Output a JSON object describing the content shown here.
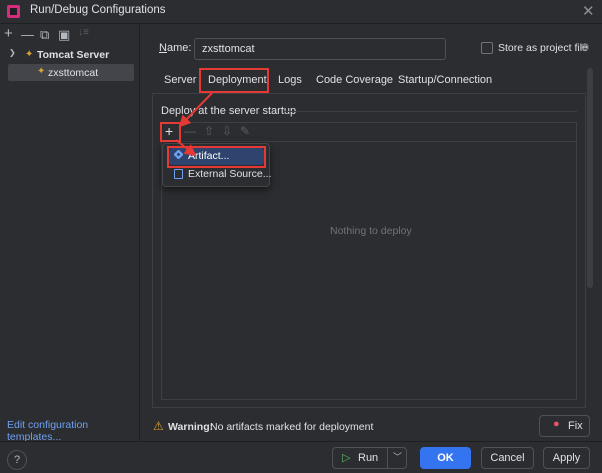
{
  "window": {
    "title": "Run/Debug Configurations",
    "close_glyph": "✕"
  },
  "left": {
    "toolbar": {
      "add": "+",
      "remove": "—",
      "copy": "⧉",
      "folder": "▣",
      "sort": "↓≡"
    },
    "tree": [
      {
        "label": "Tomcat Server",
        "icon": "tomcat-icon",
        "expanded": true
      },
      {
        "label": "zxsttomcat",
        "icon": "tomcat-icon",
        "selected": true
      }
    ],
    "edit_templates": "Edit configuration templates..."
  },
  "form": {
    "name_label": "Name:",
    "name_value": "zxsttomcat",
    "store_label": "Store as project file",
    "store_checked": false
  },
  "tabs": [
    {
      "label": "Server"
    },
    {
      "label": "Deployment",
      "active": true
    },
    {
      "label": "Logs"
    },
    {
      "label": "Code Coverage"
    },
    {
      "label": "Startup/Connection"
    }
  ],
  "deploy": {
    "title": "Deploy at the server startup",
    "empty": "Nothing to deploy",
    "toolbar": {
      "add": "+",
      "remove": "—",
      "up": "⇧",
      "down": "⇩",
      "edit": "✎"
    }
  },
  "popup": {
    "items": [
      {
        "label": "Artifact...",
        "icon": "artifact-icon",
        "highlighted": true
      },
      {
        "label": "External Source...",
        "icon": "external-source-icon"
      }
    ]
  },
  "warning": {
    "icon": "⚠",
    "bold": "Warning:",
    "message": "No artifacts marked for deployment",
    "fix_label": "Fix",
    "fix_icon": "bulb-icon"
  },
  "footer": {
    "help": "?",
    "run": "Run",
    "run_icon": "▷",
    "ok": "OK",
    "cancel": "Cancel",
    "apply": "Apply"
  },
  "colors": {
    "accent": "#3574f0",
    "annotation": "#e53935",
    "background": "#2b2d30"
  }
}
